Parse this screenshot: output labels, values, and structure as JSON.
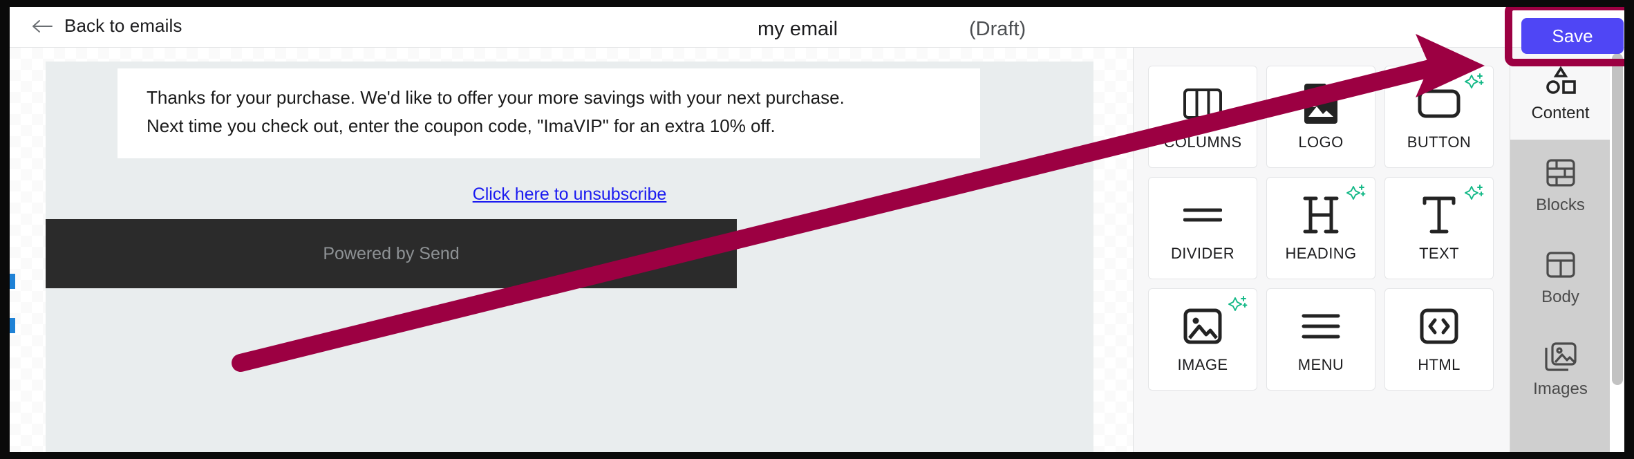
{
  "topbar": {
    "back_label": "Back to emails",
    "back_icon": "arrow-left-icon",
    "doc_title": "my email",
    "doc_status": "(Draft)",
    "save_label": "Save",
    "save_color": "#4f46f5"
  },
  "annotation": {
    "color": "#9c0042",
    "shape": "arrow-pointing-to-save-button",
    "highlight_target": "save-button"
  },
  "email": {
    "body_lines": [
      "Thanks for your purchase. We'd like to offer your more savings with your next purchase.",
      "Next time you check out, enter the coupon code, \"ImaVIP\" for an extra 10% off."
    ],
    "unsubscribe_label": "Click here to unsubscribe",
    "unsubscribe_color": "#1a1af0",
    "footer_text": "Powered by Send"
  },
  "palette": {
    "tiles": [
      {
        "label": "COLUMNS",
        "icon": "columns-icon",
        "ai": false
      },
      {
        "label": "LOGO",
        "icon": "logo-image-icon",
        "ai": false
      },
      {
        "label": "BUTTON",
        "icon": "button-icon",
        "ai": true
      },
      {
        "label": "DIVIDER",
        "icon": "divider-icon",
        "ai": false
      },
      {
        "label": "HEADING",
        "icon": "heading-icon",
        "ai": true
      },
      {
        "label": "TEXT",
        "icon": "text-icon",
        "ai": true
      },
      {
        "label": "IMAGE",
        "icon": "image-icon",
        "ai": true
      },
      {
        "label": "MENU",
        "icon": "menu-lines-icon",
        "ai": false
      },
      {
        "label": "HTML",
        "icon": "code-icon",
        "ai": false
      }
    ],
    "ai_badge_color": "#12b886"
  },
  "tab_rail": {
    "tabs": [
      {
        "label": "Content",
        "icon": "shapes-icon",
        "active": true
      },
      {
        "label": "Blocks",
        "icon": "brick-wall-icon",
        "active": false
      },
      {
        "label": "Body",
        "icon": "layout-icon",
        "active": false
      },
      {
        "label": "Images",
        "icon": "images-stack-icon",
        "active": false
      }
    ]
  }
}
